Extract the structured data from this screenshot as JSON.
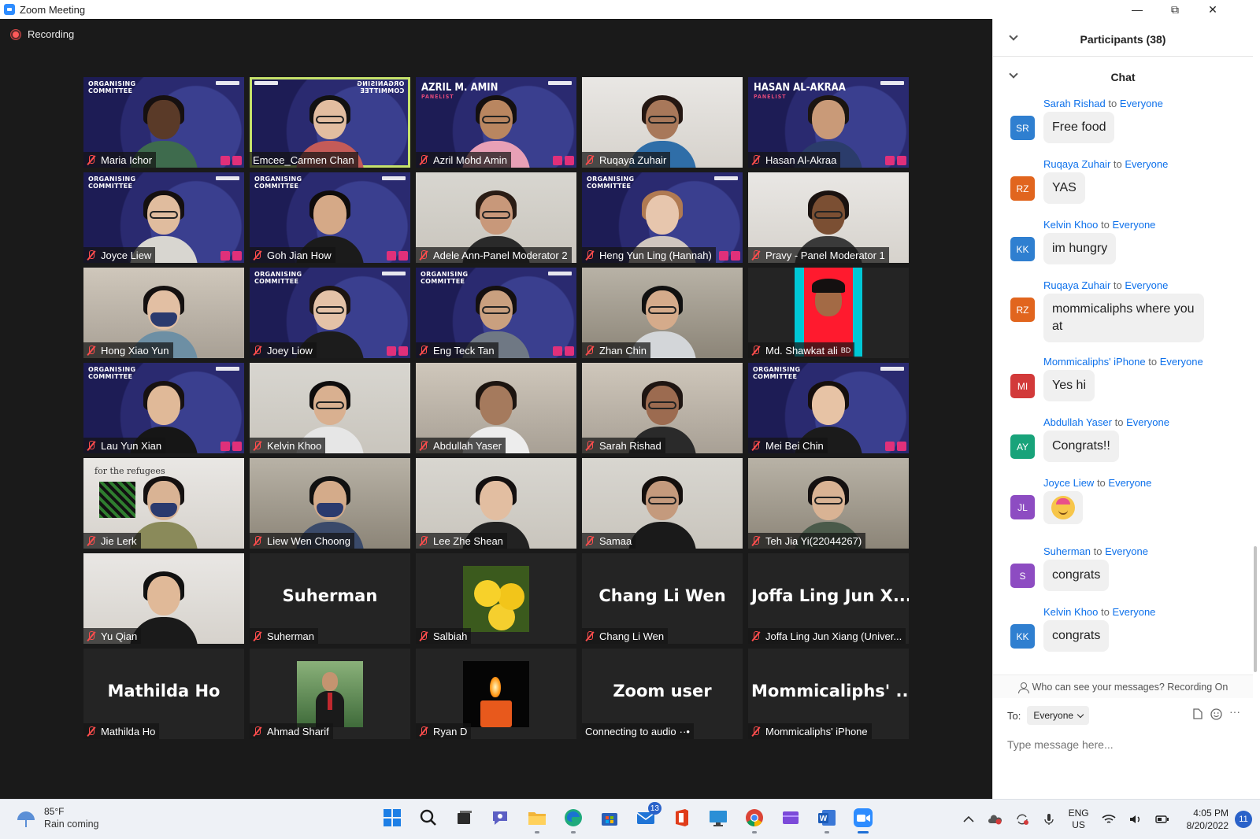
{
  "window": {
    "title": "Zoom Meeting",
    "minimize": "—",
    "restore": "⧉",
    "close": "✕"
  },
  "recording": {
    "label": "Recording"
  },
  "tiles": [
    {
      "name": "Maria Ichor",
      "bg": "bg-navy",
      "org": "ORGANISING\nCOMMITTEE",
      "muted": true,
      "badges": true,
      "skin": "#5a3a28",
      "hair": "#161010",
      "shirt": "#3e6b4d"
    },
    {
      "name": "Emcee_Carmen Chan",
      "bg": "bg-navy",
      "org": "ORGANISING\nCOMMITTEE",
      "mirrored": true,
      "muted": false,
      "active": true,
      "skin": "#e2bda0",
      "hair": "#111",
      "shirt": "#c45b58",
      "glasses": true
    },
    {
      "name": "Azril Mohd Amin",
      "bg": "bg-navy",
      "heading": "AZRIL M. AMIN",
      "sub": "PANELIST",
      "muted": true,
      "badges": true,
      "skin": "#b98660",
      "hair": "#141010",
      "shirt": "#e8a0b6",
      "glasses": true
    },
    {
      "name": "Ruqaya Zuhair",
      "bg": "bg-bright",
      "muted": true,
      "skin": "#a8785a",
      "hair": "#241712",
      "shirt": "#2f6ea8",
      "glasses": true
    },
    {
      "name": "Hasan Al-Akraa",
      "bg": "bg-navy",
      "heading": "HASAN AL-AKRAA",
      "sub": "PANELIST",
      "muted": true,
      "badges": true,
      "skin": "#c99a78",
      "hair": "#1b1511",
      "shirt": "#2b3c6b"
    },
    {
      "name": "Joyce Liew",
      "bg": "bg-navy",
      "org": "ORGANISING\nCOMMITTEE",
      "muted": true,
      "badges": true,
      "skin": "#e0bc9e",
      "hair": "#151010",
      "shirt": "#d8d6d0",
      "glasses": true
    },
    {
      "name": "Goh Jian How",
      "bg": "bg-navy",
      "org": "ORGANISING\nCOMMITTEE",
      "muted": true,
      "badges": true,
      "skin": "#d5a987",
      "hair": "#0f0c0b",
      "shirt": "#1b1b1b"
    },
    {
      "name": "Adele Ann-Panel Moderator 2",
      "bg": "bg-light",
      "muted": true,
      "skin": "#c8987a",
      "hair": "#2a1c15",
      "shirt": "#2a2a2a",
      "glasses": true
    },
    {
      "name": "Heng Yun Ling (Hannah)",
      "bg": "bg-navy",
      "org": "ORGANISING\nCOMMITTEE",
      "muted": true,
      "badges": true,
      "skin": "#e7c6ad",
      "hair": "#b07a52",
      "shirt": "#cfc6bf"
    },
    {
      "name": "Pravy - Panel Moderator 1",
      "bg": "bg-bright",
      "muted": true,
      "skin": "#7b4f33",
      "hair": "#1a1210",
      "shirt": "#3a3a3a",
      "glasses": true
    },
    {
      "name": "Hong Xiao Yun",
      "bg": "bg-warm",
      "muted": true,
      "skin": "#e2bfa3",
      "hair": "#141010",
      "shirt": "#6d8fa4",
      "mask": true
    },
    {
      "name": "Joey Liow",
      "bg": "bg-navy",
      "org": "ORGANISING\nCOMMITTEE",
      "muted": true,
      "badges": true,
      "skin": "#e4c2a7",
      "hair": "#1c1411",
      "shirt": "#1c1c1c",
      "glasses": true
    },
    {
      "name": "Eng Teck Tan",
      "bg": "bg-navy",
      "org": "ORGANISING\nCOMMITTEE",
      "muted": true,
      "badges": true,
      "skin": "#c9a07f",
      "hair": "#141010",
      "shirt": "#6f7884",
      "glasses": true
    },
    {
      "name": "Zhan Chin",
      "bg": "bg-room",
      "muted": true,
      "skin": "#d5ab8b",
      "hair": "#101010",
      "shirt": "#d3d6d9",
      "glasses": true
    },
    {
      "name": "Md. Shawkat ali",
      "bg": "bg-dark",
      "muted": true,
      "photo": "red",
      "nameSuffix": "BD"
    },
    {
      "name": "Lau Yun Xian",
      "bg": "bg-navy",
      "org": "ORGANISING\nCOMMITTEE",
      "muted": true,
      "badges": true,
      "skin": "#e0b998",
      "hair": "#171111",
      "shirt": "#161616"
    },
    {
      "name": "Kelvin Khoo",
      "bg": "bg-light",
      "muted": true,
      "skin": "#d9b090",
      "hair": "#0f0d0d",
      "shirt": "#e6e6e6",
      "glasses": true
    },
    {
      "name": "Abdullah Yaser",
      "bg": "bg-warm",
      "muted": true,
      "skin": "#a57a5d",
      "hair": "#1c1410",
      "shirt": "#ededed"
    },
    {
      "name": "Sarah Rishad",
      "bg": "bg-warm",
      "muted": true,
      "skin": "#9c6b50",
      "hair": "#1e1512",
      "shirt": "#2a2a2a",
      "glasses": true
    },
    {
      "name": "Mei Bei Chin",
      "bg": "bg-navy",
      "org": "ORGANISING\nCOMMITTEE",
      "muted": true,
      "badges": true,
      "skin": "#e7c3a5",
      "hair": "#150f0d",
      "shirt": "#1b1b1b"
    },
    {
      "name": "Jie Lerk",
      "bg": "bg-bright",
      "muted": true,
      "skin": "#d9b394",
      "hair": "#141010",
      "shirt": "#8a8a5a",
      "mask": true,
      "poster": "for the refugees"
    },
    {
      "name": "Liew Wen Choong",
      "bg": "bg-room",
      "muted": true,
      "skin": "#d4ab8a",
      "hair": "#111",
      "shirt": "#3a4a6a",
      "mask": true
    },
    {
      "name": "Lee Zhe Shean",
      "bg": "bg-light",
      "muted": true,
      "skin": "#e2bea1",
      "hair": "#141010",
      "shirt": "#222"
    },
    {
      "name": "Samaa",
      "bg": "bg-light",
      "muted": true,
      "skin": "#c49a7d",
      "hair": "#140f0d",
      "shirt": "#1a1a1a",
      "glasses": true
    },
    {
      "name": "Teh Jia Yi(22044267)",
      "bg": "bg-room",
      "muted": true,
      "skin": "#d9b394",
      "hair": "#141010",
      "shirt": "#4a5a4a",
      "glasses": true
    },
    {
      "name": "Yu Qian",
      "bg": "bg-bright",
      "muted": true,
      "skin": "#e0b998",
      "hair": "#111",
      "shirt": "#1a1a1a"
    },
    {
      "name": "Suherman",
      "bg": "bg-dark",
      "muted": true,
      "display": "Suherman"
    },
    {
      "name": "Salbiah",
      "bg": "bg-dark",
      "muted": true,
      "photo": "flower"
    },
    {
      "name": "Chang Li Wen",
      "bg": "bg-dark",
      "muted": true,
      "display": "Chang Li Wen"
    },
    {
      "name": "Joffa Ling Jun Xiang (Univer...",
      "bg": "bg-dark",
      "muted": true,
      "display": "Joffa Ling Jun X..."
    },
    {
      "name": "Mathilda Ho",
      "bg": "bg-dark",
      "muted": true,
      "display": "Mathilda Ho"
    },
    {
      "name": "Ahmad Sharif",
      "bg": "bg-dark",
      "muted": true,
      "photo": "suit"
    },
    {
      "name": "Ryan D",
      "bg": "bg-dark",
      "muted": true,
      "photo": "candle"
    },
    {
      "name": "Connecting to audio",
      "bg": "bg-dark",
      "muted": false,
      "display": "Zoom user",
      "connecting": true
    },
    {
      "name": "Mommicaliphs' iPhone",
      "bg": "bg-dark",
      "muted": true,
      "display": "Mommicaliphs' ..."
    }
  ],
  "sidebar": {
    "participants_title": "Participants (38)",
    "chat_title": "Chat",
    "messages": [
      {
        "from": "Sarah Rishad",
        "to": "to",
        "target": "Everyone",
        "initials": "SR",
        "color": "#2f7fd0",
        "text": "Free food"
      },
      {
        "from": "Ruqaya Zuhair",
        "to": "to",
        "target": "Everyone",
        "initials": "RZ",
        "color": "#e1651e",
        "text": "YAS"
      },
      {
        "from": "Kelvin Khoo",
        "to": "to",
        "target": "Everyone",
        "initials": "KK",
        "color": "#2f7fd0",
        "text": "im hungry"
      },
      {
        "from": "Ruqaya Zuhair",
        "to": "to",
        "target": "Everyone",
        "initials": "RZ",
        "color": "#e1651e",
        "text": "mommicaliphs where you at"
      },
      {
        "from": "Mommicaliphs' iPhone",
        "to": "to",
        "target": "Everyone",
        "initials": "MI",
        "color": "#d23a3a",
        "text": "Yes hi"
      },
      {
        "from": "Abdullah Yaser",
        "to": "to",
        "target": "Everyone",
        "initials": "AY",
        "color": "#18a37a",
        "text": "Congrats!!"
      },
      {
        "from": "Joyce Liew",
        "to": "to",
        "target": "Everyone",
        "initials": "JL",
        "color": "#8d4cc2",
        "text": "",
        "emoji": "partying-face"
      },
      {
        "from": "Suherman",
        "to": "to",
        "target": "Everyone",
        "initials": "S",
        "color": "#8d4cc2",
        "text": "congrats"
      },
      {
        "from": "Kelvin Khoo",
        "to": "to",
        "target": "Everyone",
        "initials": "KK",
        "color": "#2f7fd0",
        "text": "congrats"
      }
    ],
    "visibility_note": "Who can see your messages? Recording On",
    "to_label": "To:",
    "to_value": "Everyone",
    "input_placeholder": "Type message here...",
    "tools": {
      "file": "file-icon",
      "emoji": "emoji-icon",
      "more": "···"
    }
  },
  "taskbar": {
    "weather_temp": "85°F",
    "weather_condition": "Rain coming",
    "mail_badge": "13",
    "lang_line1": "ENG",
    "lang_line2": "US",
    "time": "4:05 PM",
    "date": "8/20/2022",
    "notifications": "11"
  }
}
